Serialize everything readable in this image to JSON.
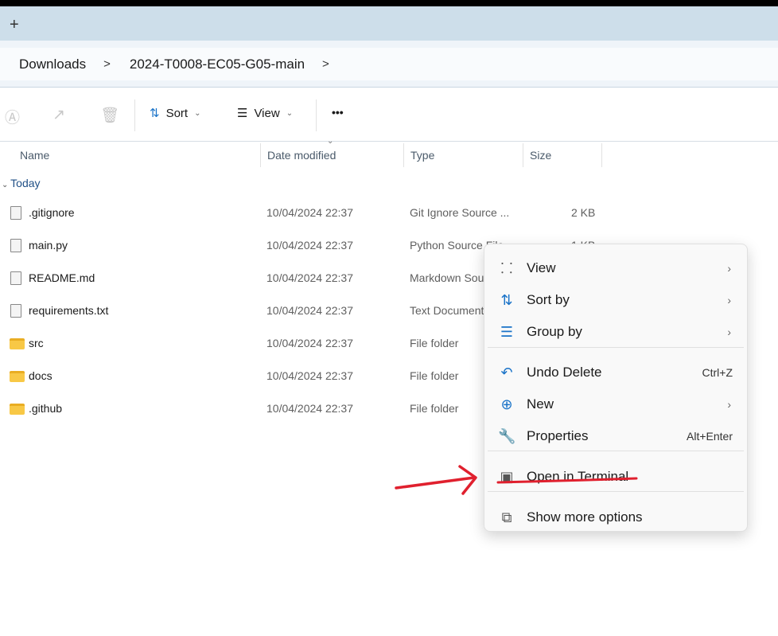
{
  "tabs": {
    "new_tab_icon": "plus-icon"
  },
  "breadcrumb": [
    "Downloads",
    "2024-T0008-EC05-G05-main"
  ],
  "toolbar": {
    "sort": "Sort",
    "view": "View",
    "more": "•••"
  },
  "columns": [
    "Name",
    "Date modified",
    "Type",
    "Size"
  ],
  "group": "Today",
  "files": [
    {
      "name": ".gitignore",
      "date": "10/04/2024 22:37",
      "type": "Git Ignore Source ...",
      "size": "2 KB",
      "icon": "file"
    },
    {
      "name": "main.py",
      "date": "10/04/2024 22:37",
      "type": "Python Source File",
      "size": "1 KB",
      "icon": "file"
    },
    {
      "name": "README.md",
      "date": "10/04/2024 22:37",
      "type": "Markdown Source File",
      "size": "",
      "icon": "file"
    },
    {
      "name": "requirements.txt",
      "date": "10/04/2024 22:37",
      "type": "Text Document",
      "size": "",
      "icon": "file"
    },
    {
      "name": "src",
      "date": "10/04/2024 22:37",
      "type": "File folder",
      "size": "",
      "icon": "folder"
    },
    {
      "name": "docs",
      "date": "10/04/2024 22:37",
      "type": "File folder",
      "size": "",
      "icon": "folder"
    },
    {
      "name": ".github",
      "date": "10/04/2024 22:37",
      "type": "File folder",
      "size": "",
      "icon": "folder"
    }
  ],
  "context_menu": [
    {
      "label": "View",
      "icon": "grid-icon",
      "submenu": true
    },
    {
      "label": "Sort by",
      "icon": "sort-icon",
      "submenu": true
    },
    {
      "label": "Group by",
      "icon": "group-icon",
      "submenu": true
    },
    {
      "label": "Undo Delete",
      "icon": "undo-icon",
      "shortcut": "Ctrl+Z"
    },
    {
      "label": "New",
      "icon": "plus-circle-icon",
      "submenu": true
    },
    {
      "label": "Properties",
      "icon": "wrench-icon",
      "shortcut": "Alt+Enter"
    },
    {
      "label": "Open in Terminal",
      "icon": "terminal-icon"
    },
    {
      "label": "Show more options",
      "icon": "share-icon"
    }
  ],
  "annotation_color": "#e0202e"
}
